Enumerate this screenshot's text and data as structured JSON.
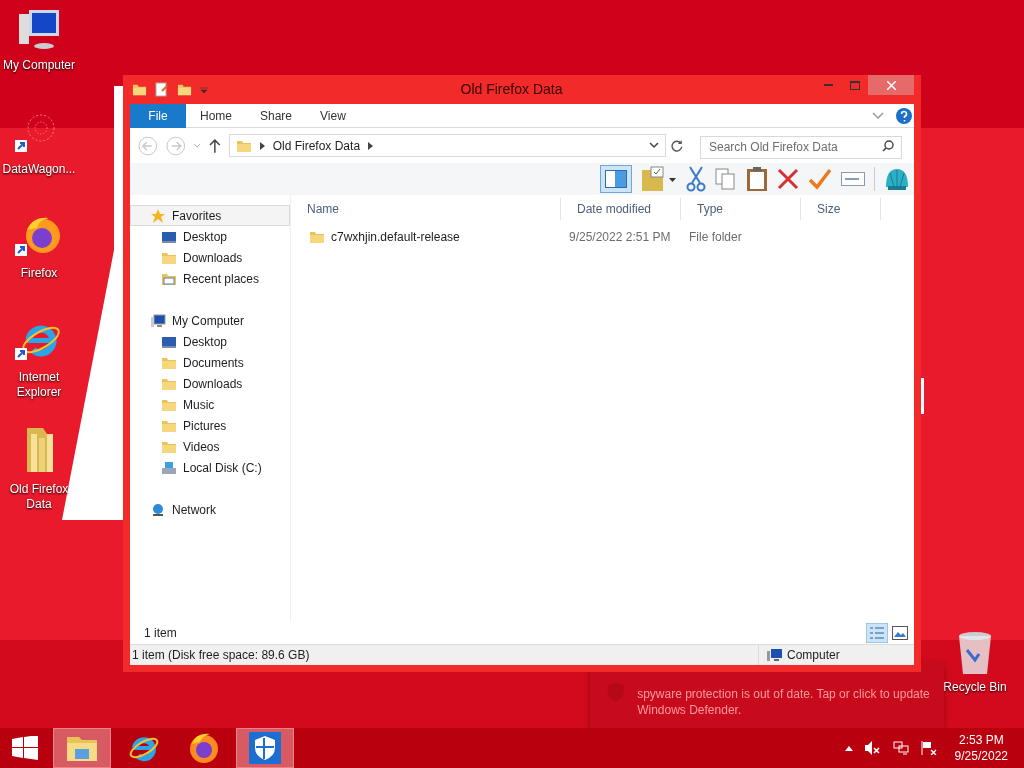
{
  "desktop_icons": [
    {
      "kind": "computer",
      "label": "My Computer"
    },
    {
      "kind": "datawagon",
      "label": "DataWagon..."
    },
    {
      "kind": "firefox",
      "label": "Firefox"
    },
    {
      "kind": "ie",
      "label": "Internet Explorer"
    },
    {
      "kind": "folder",
      "label": "Old Firefox Data"
    }
  ],
  "recycle_bin": {
    "label": "Recycle Bin"
  },
  "window": {
    "title": "Old Firefox Data",
    "ribbon_tabs": [
      {
        "label": "File",
        "selected": true
      },
      {
        "label": "Home",
        "selected": false
      },
      {
        "label": "Share",
        "selected": false
      },
      {
        "label": "View",
        "selected": false
      }
    ],
    "address": {
      "crumb": "Old Firefox Data"
    },
    "search": {
      "placeholder": "Search Old Firefox Data"
    },
    "nav": [
      {
        "kind": "star",
        "label": "Favorites",
        "selected": true,
        "children": [
          {
            "kind": "desktop",
            "label": "Desktop",
            "selected": false
          },
          {
            "kind": "folder",
            "label": "Downloads",
            "selected": false
          },
          {
            "kind": "recent",
            "label": "Recent places",
            "selected": false
          }
        ]
      },
      {
        "kind": "computer",
        "label": "My Computer",
        "selected": false,
        "children": [
          {
            "kind": "desktop",
            "label": "Desktop",
            "selected": false
          },
          {
            "kind": "folder",
            "label": "Documents",
            "selected": false
          },
          {
            "kind": "folder",
            "label": "Downloads",
            "selected": false
          },
          {
            "kind": "folder",
            "label": "Music",
            "selected": false
          },
          {
            "kind": "folder",
            "label": "Pictures",
            "selected": false
          },
          {
            "kind": "folder",
            "label": "Videos",
            "selected": false
          },
          {
            "kind": "disk",
            "label": "Local Disk (C:)",
            "selected": false
          }
        ]
      },
      {
        "kind": "network",
        "label": "Network",
        "selected": false
      }
    ],
    "columns": [
      "Name",
      "Date modified",
      "Type",
      "Size"
    ],
    "rows": [
      {
        "name": "c7wxhjin.default-release",
        "date": "9/25/2022 2:51 PM",
        "type": "File folder",
        "selected": false
      }
    ],
    "item_count": "1 item",
    "status_left": "1 item (Disk free space: 89.6 GB)",
    "status_right": "Computer"
  },
  "notification": {
    "body": "spyware protection is out of date. Tap or click to update Windows Defender."
  },
  "taskbar": {
    "items": [
      {
        "kind": "start",
        "selected": false
      },
      {
        "kind": "explorer",
        "selected": true
      },
      {
        "kind": "ie",
        "selected": false
      },
      {
        "kind": "firefox",
        "selected": false
      },
      {
        "kind": "defender",
        "selected": true
      }
    ],
    "time": "2:53 PM",
    "date": "9/25/2022"
  }
}
